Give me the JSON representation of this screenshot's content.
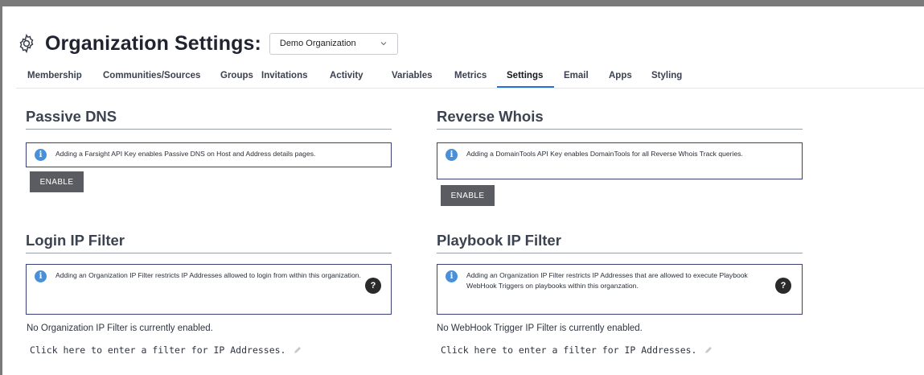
{
  "header": {
    "title": "Organization Settings:",
    "organization_select": {
      "selected": "Demo Organization"
    },
    "gear_icon": "gear-icon"
  },
  "tabs": [
    {
      "label": "Membership"
    },
    {
      "label": "Communities/Sources"
    },
    {
      "label": "Groups"
    },
    {
      "label": "Invitations"
    },
    {
      "label": "Activity"
    },
    {
      "label": "Variables"
    },
    {
      "label": "Metrics"
    },
    {
      "label": "Settings",
      "active": true
    },
    {
      "label": "Email"
    },
    {
      "label": "Apps"
    },
    {
      "label": "Styling"
    }
  ],
  "sections": {
    "passive_dns": {
      "title": "Passive DNS",
      "info": "Adding a Farsight API Key enables Passive DNS on Host and Address details pages.",
      "button": "ENABLE"
    },
    "reverse_whois": {
      "title": "Reverse Whois",
      "info": "Adding a DomainTools API Key enables DomainTools for all Reverse Whois Track queries.",
      "button": "ENABLE"
    },
    "login_ip_filter": {
      "title": "Login IP Filter",
      "info": "Adding an Organization IP Filter restricts IP Addresses allowed to login from within this organization.",
      "help": "?",
      "status": "No Organization IP Filter is currently enabled.",
      "link": "Click here to enter a filter for IP Addresses."
    },
    "playbook_ip_filter": {
      "title": "Playbook IP Filter",
      "info": "Adding an Organization IP Filter restricts IP Addresses that are allowed to execute Playbook WebHook Triggers on playbooks within this organzation.",
      "help": "?",
      "status": "No WebHook Trigger IP Filter is currently enabled.",
      "link": "Click here to enter a filter for IP Addresses."
    }
  },
  "info_icon_glyph": "i",
  "colors": {
    "accent": "#2d6fd8",
    "info": "#4a90d9",
    "button": "#5a5c61",
    "box_border": "#3b3f78"
  }
}
